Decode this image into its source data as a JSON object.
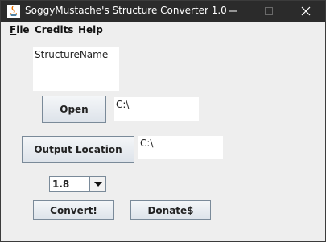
{
  "window": {
    "title": "SoggyMustache's Structure Converter 1.0"
  },
  "menu": {
    "file": {
      "mnemonic": "F",
      "rest": "ile"
    },
    "credits": {
      "label": "Credits"
    },
    "help": {
      "label": "Help"
    }
  },
  "form": {
    "structure_name": "StructureName",
    "open_label": "Open",
    "open_path": "C:\\",
    "output_location_label": "Output Location",
    "output_path": "C:\\",
    "version_selected": "1.8",
    "convert_label": "Convert!",
    "donate_label": "Donate$"
  },
  "icons": {
    "app": "java-app-icon",
    "minimize": "minimize-icon",
    "maximize": "maximize-icon",
    "close": "close-icon",
    "dropdown": "chevron-down-icon"
  },
  "colors": {
    "titlebar": "#2b2b2b",
    "window_bg": "#eeeeee",
    "button_border": "#7a8a99"
  }
}
